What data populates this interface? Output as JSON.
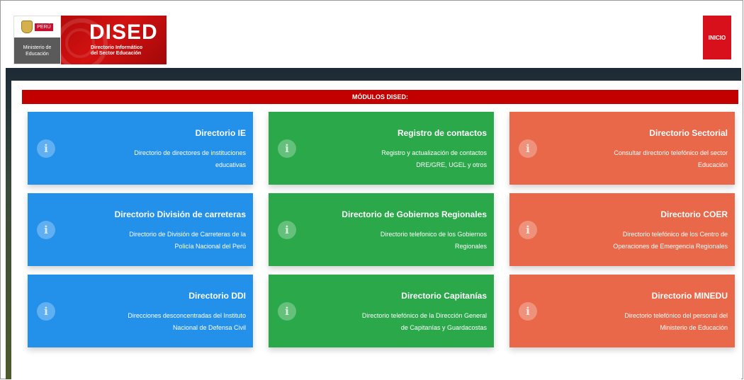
{
  "header": {
    "peru_label": "PERÚ",
    "ministry_label": "Ministerio de Educación",
    "brand_title": "DISED",
    "brand_subtitle_1": "Directorio Informático",
    "brand_subtitle_2": "del Sector Educación",
    "inicio_label": "INICIO"
  },
  "section": {
    "title": "MÓDULOS DISED:"
  },
  "cards": [
    {
      "title": "Directorio IE",
      "desc_1": "Directorio de directores de instituciones",
      "desc_2": "educativas",
      "color": "#2390ea",
      "icon": "info-icon"
    },
    {
      "title": "Registro de contactos",
      "desc_1": "Registro y actualización de contactos",
      "desc_2": "DRE/GRE, UGEL y otros",
      "color": "#2aa84a",
      "icon": "info-icon"
    },
    {
      "title": "Directorio Sectorial",
      "desc_1": "Consultar directorio telefónico del sector",
      "desc_2": "Educación",
      "color": "#e9684a",
      "icon": "info-icon"
    },
    {
      "title": "Directorio División de carreteras",
      "desc_1": "Directorio de División de Carreteras de la",
      "desc_2": "Policía Nacional del Perú",
      "color": "#2390ea",
      "icon": "info-icon"
    },
    {
      "title": "Directorio de Gobiernos Regionales",
      "desc_1": "Directorio telefonico de los Gobiernos",
      "desc_2": "Regionales",
      "color": "#2aa84a",
      "icon": "info-icon"
    },
    {
      "title": "Directorio COER",
      "desc_1": "Directorio telefónico de los Centro de",
      "desc_2": "Operaciones de Emergencia Regionales",
      "color": "#e9684a",
      "icon": "info-icon"
    },
    {
      "title": "Directorio DDI",
      "desc_1": "Direcciones desconcentradas del Instituto",
      "desc_2": "Nacional de Defensa Civil",
      "color": "#2390ea",
      "icon": "info-icon"
    },
    {
      "title": "Directorio Capitanías",
      "desc_1": "Directorio telefónico de la Dirección General",
      "desc_2": "de Capitanías y Guardacostas",
      "color": "#2aa84a",
      "icon": "info-icon"
    },
    {
      "title": "Directorio MINEDU",
      "desc_1": "Directorio telefónico del personal del",
      "desc_2": "Ministerio de Educación",
      "color": "#e9684a",
      "icon": "info-icon"
    }
  ]
}
